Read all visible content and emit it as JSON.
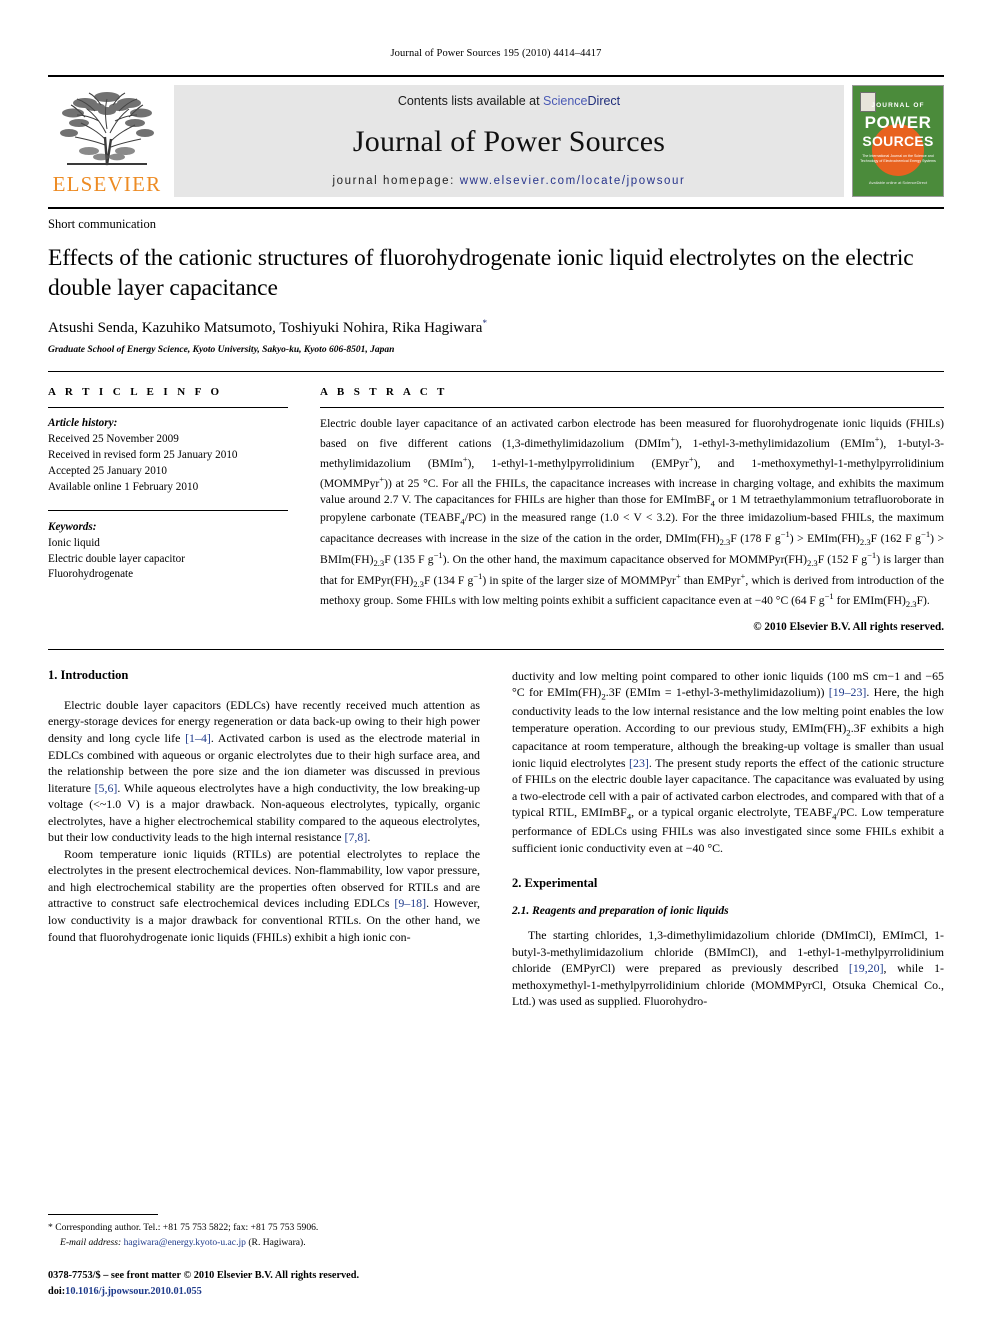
{
  "running_head": "Journal of Power Sources 195 (2010) 4414–4417",
  "masthead": {
    "publisher": "ELSEVIER",
    "contents_prefix": "Contents lists available at ",
    "sciencedirect_a": "Science",
    "sciencedirect_b": "Direct",
    "journal_title": "Journal of Power Sources",
    "homepage_label": "journal homepage: ",
    "homepage_url": "www.elsevier.com/locate/jpowsour",
    "cover": {
      "line1": "JOURNAL OF",
      "line2": "POWER",
      "line3": "SOURCES",
      "subtitle": "The International Journal on the Science and Technology of Electrochemical Energy Systems",
      "footer": "Available online at\nScienceDirect",
      "bg_color": "#4b8b3b",
      "accent_color": "#E8621F"
    }
  },
  "article": {
    "doctype": "Short communication",
    "title": "Effects of the cationic structures of fluorohydrogenate ionic liquid electrolytes on the electric double layer capacitance",
    "authors": "Atsushi Senda, Kazuhiko Matsumoto, Toshiyuki Nohira, Rika Hagiwara",
    "corresponding_marker": "*",
    "affiliation": "Graduate School of Energy Science, Kyoto University, Sakyo-ku, Kyoto 606-8501, Japan"
  },
  "article_info": {
    "heading": "A R T I C L E    I N F O",
    "history_label": "Article history:",
    "history": [
      "Received 25 November 2009",
      "Received in revised form 25 January 2010",
      "Accepted 25 January 2010",
      "Available online 1 February 2010"
    ],
    "keywords_label": "Keywords:",
    "keywords": [
      "Ionic liquid",
      "Electric double layer capacitor",
      "Fluorohydrogenate"
    ]
  },
  "abstract": {
    "heading": "A B S T R A C T",
    "text_parts": [
      "Electric double layer capacitance of an activated carbon electrode has been measured for fluorohydrogenate ionic liquids (FHILs) based on five different cations (1,3-dimethylimidazolium (DMIm",
      "), 1-ethyl-3-methylimidazolium (EMIm",
      "), 1-butyl-3-methylimidazolium (BMIm",
      "), 1-ethyl-1-methylpyrrolidinium (EMPyr",
      "), and 1-methoxymethyl-1-methylpyrrolidinium (MOMMPyr",
      ")) at 25 °C. For all the FHILs, the capacitance increases with increase in charging voltage, and exhibits the maximum value around 2.7 V. The capacitances for FHILs are higher than those for EMImBF",
      " or 1 M tetraethylammonium tetrafluoroborate in propylene carbonate (TEABF",
      "/PC) in the measured range (1.0 < V < 3.2). For the three imidazolium-based FHILs, the maximum capacitance decreases with increase in the size of the cation in the order, DMIm(FH)",
      "F (178 F g",
      ") > EMIm(FH)",
      "F (162 F g",
      ") > BMIm(FH)",
      "F (135 F g",
      "). On the other hand, the maximum capacitance observed for MOMMPyr(FH)",
      "F (152 F g",
      ") is larger than that for EMPyr(FH)",
      "F (134 F g",
      ") in spite of the larger size of MOMMPyr",
      " than EMPyr",
      ", which is derived from introduction of the methoxy group. Some FHILs with low melting points exhibit a sufficient capacitance even at −40 °C (64 F g",
      " for EMIm(FH)",
      "F)."
    ],
    "copyright": "© 2010 Elsevier B.V. All rights reserved."
  },
  "sections": {
    "intro_heading": "1.  Introduction",
    "intro_p1": "Electric double layer capacitors (EDLCs) have recently received much attention as energy-storage devices for energy regeneration or data back-up owing to their high power density and long cycle life [1–4]. Activated carbon is used as the electrode material in EDLCs combined with aqueous or organic electrolytes due to their high surface area, and the relationship between the pore size and the ion diameter was discussed in previous literature [5,6]. While aqueous electrolytes have a high conductivity, the low breaking-up voltage (<~1.0 V) is a major drawback. Non-aqueous electrolytes, typically, organic electrolytes, have a higher electrochemical stability compared to the aqueous electrolytes, but their low conductivity leads to the high internal resistance [7,8].",
    "intro_p2": "Room temperature ionic liquids (RTILs) are potential electrolytes to replace the electrolytes in the present electrochemical devices. Non-flammability, low vapor pressure, and high electrochemical stability are the properties often observed for RTILs and are attractive to construct safe electrochemical devices including EDLCs [9–18]. However, low conductivity is a major drawback for conventional RTILs. On the other hand, we found that fluorohydrogenate ionic liquids (FHILs) exhibit a high ionic con-",
    "intro_p2_right": "ductivity and low melting point compared to other ionic liquids (100 mS cm−1 and −65 °C for EMIm(FH)2.3F (EMIm = 1-ethyl-3-methylimidazolium)) [19–23]. Here, the high conductivity leads to the low internal resistance and the low melting point enables the low temperature operation. According to our previous study, EMIm(FH)2.3F exhibits a high capacitance at room temperature, although the breaking-up voltage is smaller than usual ionic liquid electrolytes [23]. The present study reports the effect of the cationic structure of FHILs on the electric double layer capacitance. The capacitance was evaluated by using a two-electrode cell with a pair of activated carbon electrodes, and compared with that of a typical RTIL, EMImBF4, or a typical organic electrolyte, TEABF4/PC. Low temperature performance of EDLCs using FHILs was also investigated since some FHILs exhibit a sufficient ionic conductivity even at −40 °C.",
    "exp_heading": "2.  Experimental",
    "exp_sub_heading": "2.1.  Reagents and preparation of ionic liquids",
    "exp_p1": "The starting chlorides, 1,3-dimethylimidazolium chloride (DMImCl), EMImCl, 1-butyl-3-methylimidazolium chloride (BMImCl), and 1-ethyl-1-methylpyrrolidinium chloride (EMPyrCl) were prepared as previously described [19,20], while 1-methoxymethyl-1-methylpyrrolidinium chloride (MOMMPyrCl, Otsuka Chemical Co., Ltd.) was used as supplied. Fluorohydro-"
  },
  "footnote": {
    "marker": "*",
    "corresponding": "Corresponding author. Tel.: +81 75 753 5822; fax: +81 75 753 5906.",
    "email_label": "E-mail address:",
    "email": "hagiwara@energy.kyoto-u.ac.jp",
    "email_suffix": "(R. Hagiwara).",
    "issn_line": "0378-7753/$ – see front matter © 2010 Elsevier B.V. All rights reserved.",
    "doi_label": "doi:",
    "doi": "10.1016/j.jpowsour.2010.01.055"
  }
}
